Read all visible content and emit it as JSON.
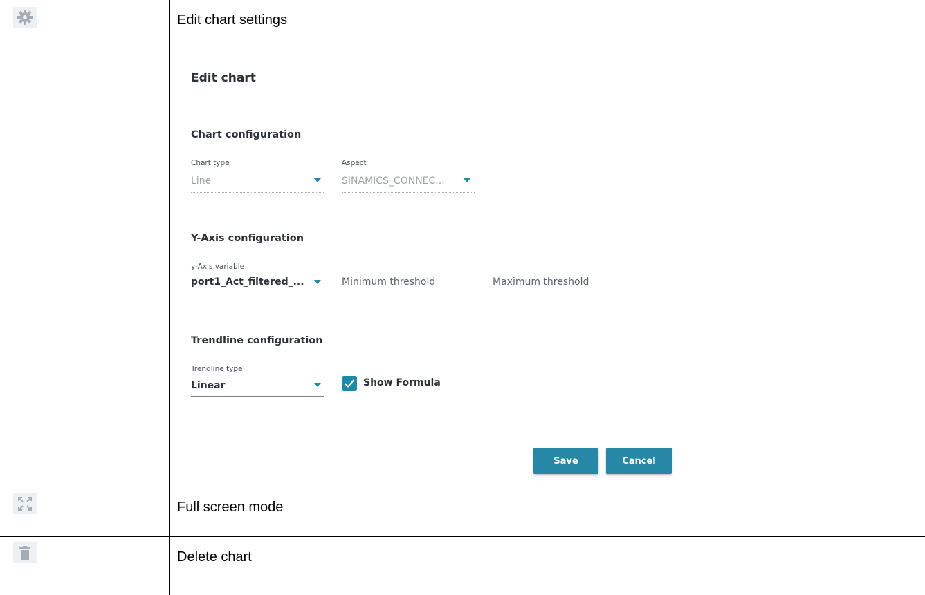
{
  "rows": [
    {
      "icon": "gear-icon",
      "label": "Edit chart settings"
    },
    {
      "icon": "fullscreen-icon",
      "label": "Full screen mode"
    },
    {
      "icon": "trash-icon",
      "label": "Delete chart"
    }
  ],
  "dialog": {
    "title": "Edit chart",
    "chart_config": {
      "heading": "Chart configuration",
      "chart_type": {
        "label": "Chart type",
        "value": "Line"
      },
      "aspect": {
        "label": "Aspect",
        "value": "SINAMICS_CONNEC..."
      }
    },
    "y_axis_config": {
      "heading": "Y-Axis configuration",
      "variable": {
        "label": "y-Axis variable",
        "value": "port1_Act_filtered_..."
      },
      "min_threshold_placeholder": "Minimum threshold",
      "max_threshold_placeholder": "Maximum threshold"
    },
    "trendline_config": {
      "heading": "Trendline configuration",
      "type": {
        "label": "Trendline type",
        "value": "Linear"
      },
      "show_formula": {
        "label": "Show Formula",
        "checked": true
      }
    },
    "buttons": {
      "save": "Save",
      "cancel": "Cancel"
    }
  },
  "colors": {
    "accent": "#1e8aa8",
    "button": "#2688a6",
    "icon_bg": "#eef1f3",
    "icon_fg": "#a4adb5"
  }
}
